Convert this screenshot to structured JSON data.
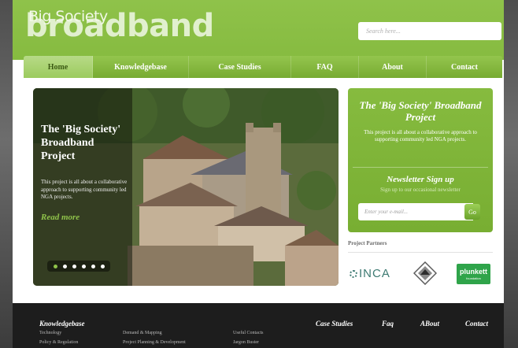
{
  "header": {
    "logo_small": "Big Society",
    "logo_big": "broadband",
    "search_placeholder": "Search here..."
  },
  "nav": {
    "items": [
      {
        "label": "Home",
        "active": true
      },
      {
        "label": "Knowledgebase"
      },
      {
        "label": "Case Studies"
      },
      {
        "label": "FAQ"
      },
      {
        "label": "About"
      },
      {
        "label": "Contact"
      }
    ]
  },
  "hero": {
    "title": "The 'Big Society' Broadband Project",
    "description": "This project is all about a collaborative approach to supporting community led NGA projects.",
    "read_more": "Read more",
    "slides": 6,
    "active_slide": 1
  },
  "sidebar": {
    "title": "The 'Big Society' Broadband Project",
    "description": "This project is all about a collaborative approach to supporting community led NGA projects.",
    "newsletter_title": "Newsletter Sign up",
    "newsletter_subtitle": "Sign up to our occasional newsletter",
    "email_placeholder": "Enter your e-mail...",
    "go_label": "Go"
  },
  "partners": {
    "title": "Project Partners",
    "inca": "INCA",
    "acre": "ACRE",
    "plunkett_name": "plunkett",
    "plunkett_sub": "foundation"
  },
  "footer": {
    "knowledgebase": "Knowledgebase",
    "links_col1": [
      "Technology",
      "Policy & Regulation"
    ],
    "links_col2": [
      "Demand & Mapping",
      "Project Planning & Development"
    ],
    "links_col3": [
      "Useful Contacts",
      "Jargon Buster"
    ],
    "case_studies": "Case Studies",
    "faq": "Faq",
    "about": "ABout",
    "contact": "Contact"
  },
  "colors": {
    "brand_green": "#86bb3f",
    "footer_bg": "#1d1d1d"
  }
}
